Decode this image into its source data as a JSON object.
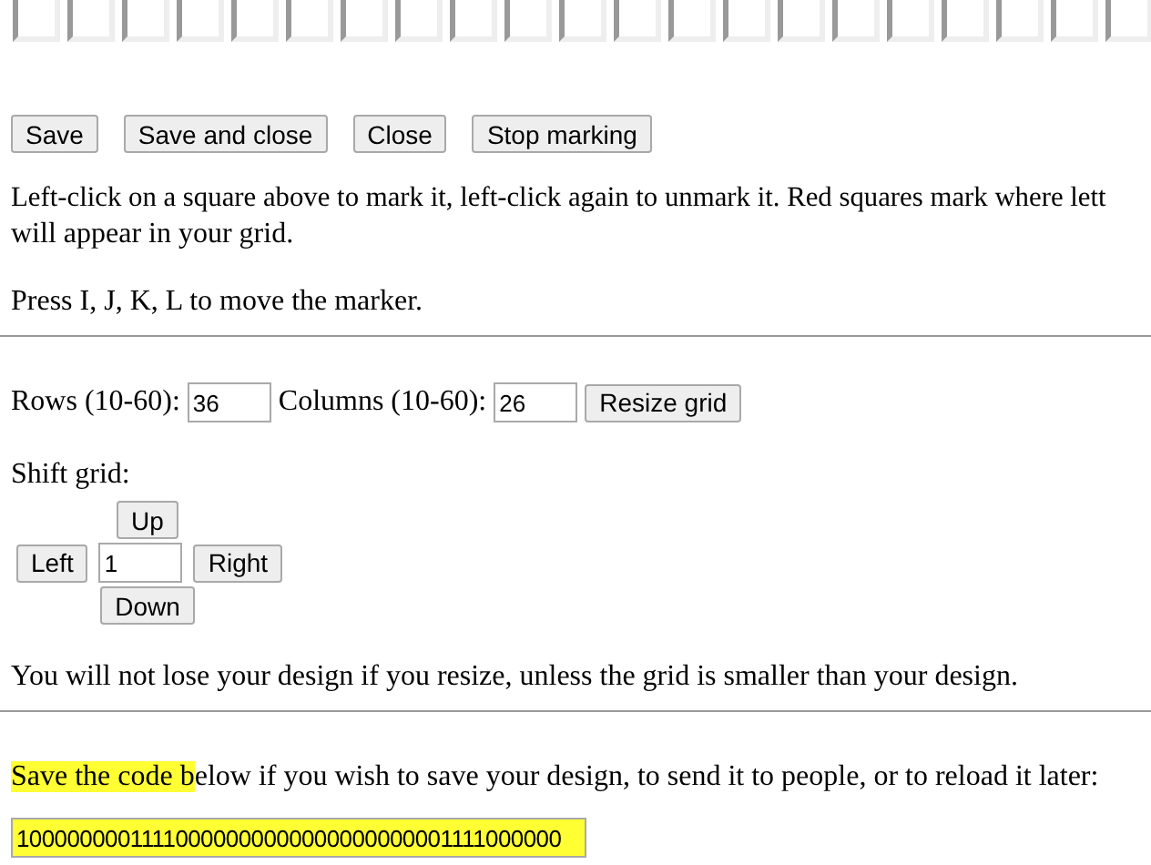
{
  "grid": [
    {
      "marked": false
    },
    {
      "marked": false
    },
    {
      "marked": false
    },
    {
      "marked": false
    },
    {
      "marked": false
    },
    {
      "marked": false
    },
    {
      "marked": false
    },
    {
      "marked": false
    },
    {
      "marked": false
    },
    {
      "marked": false
    },
    {
      "marked": false
    },
    {
      "marked": false
    },
    {
      "marked": false
    },
    {
      "marked": false
    },
    {
      "marked": false
    },
    {
      "marked": false
    },
    {
      "marked": false
    },
    {
      "marked": false
    },
    {
      "marked": false
    },
    {
      "marked": false
    },
    {
      "marked": false
    }
  ],
  "actions": [
    "Save",
    "Save and close",
    "Close",
    "Stop marking"
  ],
  "instructions": [
    "Left-click on a square above to mark it, left-click again to unmark it. Red squares mark where lett",
    "will appear in your grid."
  ],
  "keys_hint": "Press I, J, K, L to move the marker.",
  "resize": {
    "rows_label": "Rows (10-60):",
    "rows_value": "36",
    "columns_label": "Columns (10-60):",
    "columns_value": "26",
    "button": "Resize grid"
  },
  "shift": {
    "label": "Shift grid:",
    "up": "Up",
    "left": "Left",
    "amount": "1",
    "right": "Right",
    "down": "Down"
  },
  "resize_note": "You will not lose your design if you resize, unless the grid is smaller than your design.",
  "save_note": {
    "highlighted": "Save the code b",
    "rest": "elow if you wish to save your design, to send it to people, or to reload it later:"
  },
  "code": {
    "value": "10000000011110000000000000000000001111000000",
    "highlighted": true
  }
}
